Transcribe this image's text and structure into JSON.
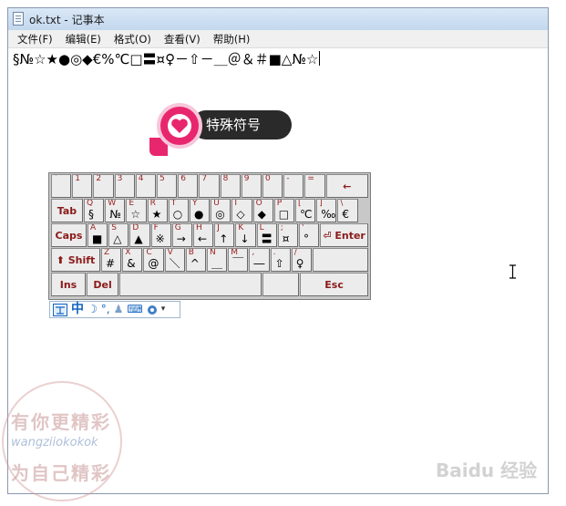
{
  "window": {
    "title": "ok.txt - 记事本"
  },
  "menu": [
    "文件(F)",
    "编辑(E)",
    "格式(O)",
    "查看(V)",
    "帮助(H)"
  ],
  "document": {
    "text": "§№☆★●◎◆€%℃□〓¤♀－⇧－＿＠＆＃■△№☆"
  },
  "badge": {
    "label": "特殊符号"
  },
  "keyboard": {
    "row1": [
      {
        "t": "`",
        "s": ""
      },
      {
        "t": "1",
        "s": ""
      },
      {
        "t": "2",
        "s": ""
      },
      {
        "t": "3",
        "s": ""
      },
      {
        "t": "4",
        "s": ""
      },
      {
        "t": "5",
        "s": ""
      },
      {
        "t": "6",
        "s": ""
      },
      {
        "t": "7",
        "s": ""
      },
      {
        "t": "8",
        "s": ""
      },
      {
        "t": "9",
        "s": ""
      },
      {
        "t": "0",
        "s": ""
      },
      {
        "t": "-",
        "s": ""
      },
      {
        "t": "=",
        "s": ""
      }
    ],
    "backspace": "←",
    "tab": "Tab",
    "row2": [
      {
        "t": "Q",
        "s": "§"
      },
      {
        "t": "W",
        "s": "№"
      },
      {
        "t": "E",
        "s": "☆"
      },
      {
        "t": "R",
        "s": "★"
      },
      {
        "t": "T",
        "s": "○"
      },
      {
        "t": "Y",
        "s": "●"
      },
      {
        "t": "U",
        "s": "◎"
      },
      {
        "t": "I",
        "s": "◇"
      },
      {
        "t": "O",
        "s": "◆"
      },
      {
        "t": "P",
        "s": "□"
      },
      {
        "t": "[",
        "s": "℃"
      },
      {
        "t": "]",
        "s": "‰"
      },
      {
        "t": "\\",
        "s": "€"
      }
    ],
    "caps": "Caps",
    "row3": [
      {
        "t": "A",
        "s": "■"
      },
      {
        "t": "S",
        "s": "△"
      },
      {
        "t": "D",
        "s": "▲"
      },
      {
        "t": "F",
        "s": "※"
      },
      {
        "t": "G",
        "s": "→"
      },
      {
        "t": "H",
        "s": "←"
      },
      {
        "t": "J",
        "s": "↑"
      },
      {
        "t": "K",
        "s": "↓"
      },
      {
        "t": "L",
        "s": "〓"
      },
      {
        "t": ";",
        "s": "¤"
      },
      {
        "t": "'",
        "s": "°"
      }
    ],
    "enter": "Enter",
    "shift": "Shift",
    "row4": [
      {
        "t": "Z",
        "s": "#"
      },
      {
        "t": "X",
        "s": "&"
      },
      {
        "t": "C",
        "s": "@"
      },
      {
        "t": "V",
        "s": "＼"
      },
      {
        "t": "B",
        "s": "^"
      },
      {
        "t": "N",
        "s": "＿"
      },
      {
        "t": "M",
        "s": "￣"
      },
      {
        "t": ",",
        "s": "―"
      },
      {
        "t": ".",
        "s": "⇧"
      },
      {
        "t": "/",
        "s": "♀"
      }
    ],
    "ins": "Ins",
    "del": "Del",
    "esc": "Esc"
  },
  "ime": {
    "mode": "中",
    "moon": "☽",
    "punct": "°,",
    "person": "♟",
    "kbd": "⌨",
    "extra": "▾"
  },
  "watermark": {
    "line1": "有你更精彩",
    "line2": "wangziiokokok",
    "line3": "为自己精彩",
    "baidu": "Baidu 经验"
  },
  "colors": {
    "accent": "#e8266e",
    "keyLabel": "#9a1f1f"
  }
}
